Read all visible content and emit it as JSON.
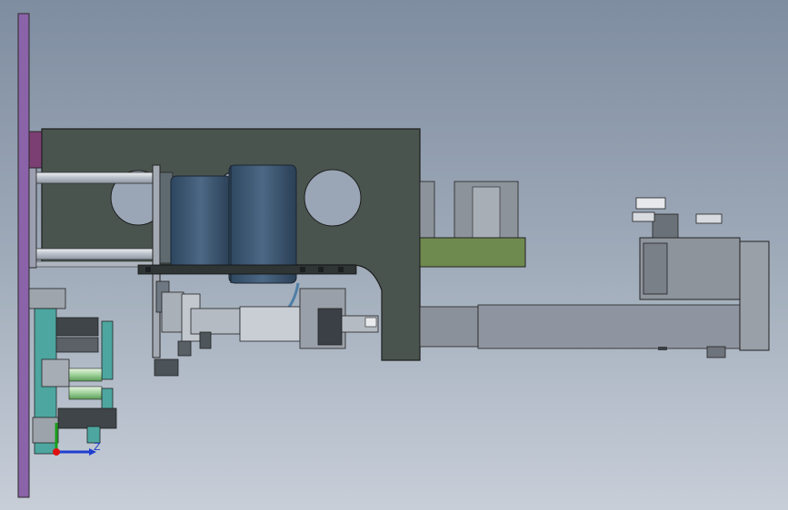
{
  "viewport": {
    "background_top": "#7f8da1",
    "background_bottom": "#c7ced8"
  },
  "triad": {
    "axis_z_label": "Z",
    "colors": {
      "x_axis": "#1f3fd0",
      "y_axis": "#1aa01a",
      "origin": "#e01010"
    }
  },
  "colors": {
    "base_plate": "#8a63a8",
    "main_frame": "#4a544f",
    "roller": "#3b5670",
    "green_bracket": "#6f8a4e",
    "rail": "#8b919b",
    "motor": "#8e949c",
    "cyan_parts": "#4da6a0"
  }
}
